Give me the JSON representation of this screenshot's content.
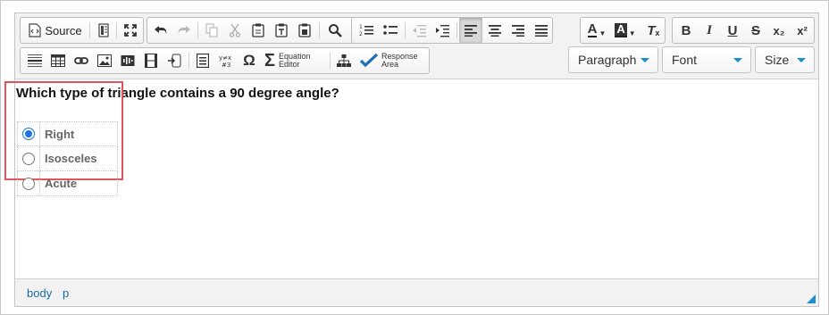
{
  "toolbar": {
    "source_label": "Source",
    "equation_label_line1": "Equation",
    "equation_label_line2": "Editor",
    "response_label_line1": "Response",
    "response_label_line2": "Area",
    "special_char_glyph": "Ω",
    "sigma_glyph": "Σ",
    "clear_format_glyph": "T",
    "bold_glyph": "B",
    "italic_glyph": "I",
    "underline_glyph": "U",
    "strike_glyph": "S",
    "subscript_glyph": "x₂",
    "superscript_glyph": "x²",
    "text_color_glyph": "A",
    "bg_color_glyph": "A",
    "align_justify_active": false,
    "align_left_active": true
  },
  "format_combo": {
    "value": "Paragraph"
  },
  "font_combo": {
    "value": "Font"
  },
  "size_combo": {
    "value": "Size"
  },
  "content": {
    "question": "Which type of triangle contains a 90 degree angle?",
    "options": [
      {
        "label": "Right",
        "checked": true
      },
      {
        "label": "Isosceles",
        "checked": false
      },
      {
        "label": "Acute",
        "checked": false
      }
    ]
  },
  "statusbar": {
    "path": [
      "body",
      "p"
    ]
  },
  "colors": {
    "accent": "#1a8fd1",
    "highlight_border": "#e0545a",
    "radio_selected": "#1a73e8"
  }
}
